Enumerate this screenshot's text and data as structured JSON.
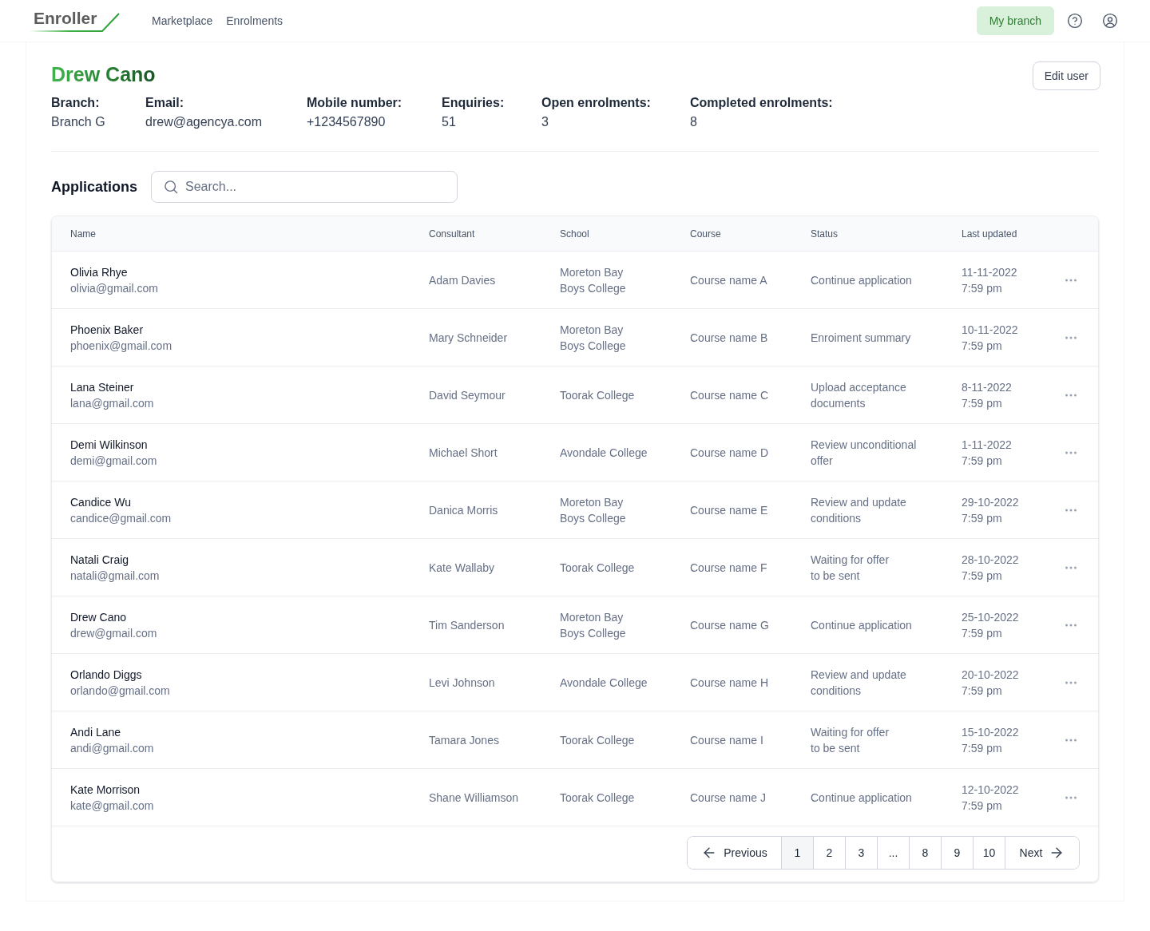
{
  "nav": {
    "logo": "Enroller",
    "links": [
      {
        "label": "Marketplace"
      },
      {
        "label": "Enrolments"
      }
    ],
    "branch_button": "My branch"
  },
  "profile": {
    "name": "Drew Cano",
    "edit_button": "Edit user",
    "fields": [
      {
        "label": "Branch:",
        "value": "Branch G"
      },
      {
        "label": "Email:",
        "value": "drew@agencya.com"
      },
      {
        "label": "Mobile number:",
        "value": "+1234567890"
      },
      {
        "label": "Enquiries:",
        "value": "51"
      },
      {
        "label": "Open enrolments:",
        "value": "3"
      },
      {
        "label": "Completed enrolments:",
        "value": "8"
      }
    ]
  },
  "applications": {
    "title": "Applications",
    "search": {
      "placeholder": "Search..."
    },
    "table": {
      "columns": [
        "Name",
        "Consultant",
        "School",
        "Course",
        "Status",
        "Last updated"
      ],
      "rows": [
        {
          "name": "Olivia Rhye",
          "email": "olivia@gmail.com",
          "consultant": "Adam Davies",
          "school": "Moreton Bay\nBoys College",
          "course": "Course name A",
          "status": "Continue application",
          "date": "11-11-2022",
          "time": "7:59 pm"
        },
        {
          "name": "Phoenix Baker",
          "email": "phoenix@gmail.com",
          "consultant": "Mary Schneider",
          "school": "Moreton Bay\nBoys College",
          "course": "Course name B",
          "status": "Enroiment summary",
          "date": "10-11-2022",
          "time": "7:59 pm"
        },
        {
          "name": "Lana Steiner",
          "email": "lana@gmail.com",
          "consultant": "David Seymour",
          "school": "Toorak College",
          "course": "Course name C",
          "status": "Upload acceptance\ndocuments",
          "date": "8-11-2022",
          "time": "7:59 pm"
        },
        {
          "name": "Demi Wilkinson",
          "email": "demi@gmail.com",
          "consultant": "Michael Short",
          "school": "Avondale College",
          "course": "Course name D",
          "status": "Review unconditional\noffer",
          "date": "1-11-2022",
          "time": "7:59 pm"
        },
        {
          "name": "Candice Wu",
          "email": "candice@gmail.com",
          "consultant": "Danica Morris",
          "school": "Moreton Bay\nBoys College",
          "course": "Course name E",
          "status": "Review and update\nconditions",
          "date": "29-10-2022",
          "time": "7:59 pm"
        },
        {
          "name": "Natali Craig",
          "email": "natali@gmail.com",
          "consultant": "Kate Wallaby",
          "school": "Toorak College",
          "course": "Course name F",
          "status": "Waiting for offer\nto be sent",
          "date": "28-10-2022",
          "time": "7:59 pm"
        },
        {
          "name": "Drew Cano",
          "email": "drew@gmail.com",
          "consultant": "Tim Sanderson",
          "school": "Moreton Bay\nBoys College",
          "course": "Course name G",
          "status": "Continue application",
          "date": "25-10-2022",
          "time": "7:59 pm"
        },
        {
          "name": "Orlando Diggs",
          "email": "orlando@gmail.com",
          "consultant": "Levi Johnson",
          "school": "Avondale College",
          "course": "Course name H",
          "status": "Review and update\nconditions",
          "date": "20-10-2022",
          "time": "7:59 pm"
        },
        {
          "name": "Andi Lane",
          "email": "andi@gmail.com",
          "consultant": "Tamara Jones",
          "school": "Toorak College",
          "course": "Course name I",
          "status": "Waiting for offer\nto be sent",
          "date": "15-10-2022",
          "time": "7:59 pm"
        },
        {
          "name": "Kate Morrison",
          "email": "kate@gmail.com",
          "consultant": "Shane Williamson",
          "school": "Toorak College",
          "course": "Course name J",
          "status": "Continue application",
          "date": "12-10-2022",
          "time": "7:59 pm"
        }
      ]
    },
    "pagination": {
      "previous": "Previous",
      "next": "Next",
      "pages": [
        {
          "label": "1",
          "selected": true
        },
        {
          "label": "2",
          "selected": false
        },
        {
          "label": "3",
          "selected": false
        },
        {
          "label": "...",
          "selected": false
        },
        {
          "label": "8",
          "selected": false
        },
        {
          "label": "9",
          "selected": false
        },
        {
          "label": "10",
          "selected": false
        }
      ]
    }
  }
}
